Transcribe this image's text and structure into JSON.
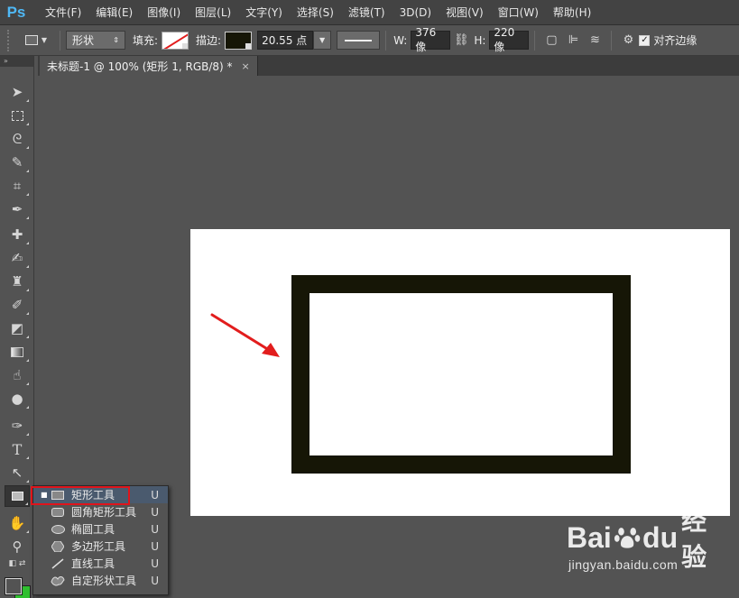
{
  "app": {
    "logo": "Ps",
    "accent": "#4fb8f5"
  },
  "menu": [
    "文件(F)",
    "编辑(E)",
    "图像(I)",
    "图层(L)",
    "文字(Y)",
    "选择(S)",
    "滤镜(T)",
    "3D(D)",
    "视图(V)",
    "窗口(W)",
    "帮助(H)"
  ],
  "options": {
    "mode_value": "形状",
    "fill_label": "填充:",
    "stroke_label": "描边:",
    "stroke_width": "20.55 点",
    "w_label": "W:",
    "w_value": "376 像",
    "h_label": "H:",
    "h_value": "220 像",
    "align_edges_label": "对齐边缘",
    "fill_color": "#ffffff",
    "stroke_color": "#161606"
  },
  "document": {
    "tab_title": "未标题-1 @ 100% (矩形 1, RGB/8) *",
    "close_glyph": "×",
    "canvas_color": "#ffffff"
  },
  "toolbox": {
    "header": "»"
  },
  "flyout": {
    "items": [
      {
        "label": "矩形工具",
        "shortcut": "U",
        "icon": "rectangle-icon"
      },
      {
        "label": "圆角矩形工具",
        "shortcut": "U",
        "icon": "rounded-rectangle-icon"
      },
      {
        "label": "椭圆工具",
        "shortcut": "U",
        "icon": "ellipse-icon"
      },
      {
        "label": "多边形工具",
        "shortcut": "U",
        "icon": "polygon-icon"
      },
      {
        "label": "直线工具",
        "shortcut": "U",
        "icon": "line-icon"
      },
      {
        "label": "自定形状工具",
        "shortcut": "U",
        "icon": "custom-shape-icon"
      }
    ],
    "selected_marker": "■",
    "highlight_color": "#e0141b"
  },
  "watermark": {
    "brand_a": "Bai",
    "brand_b": "du",
    "brand_cn": "经验",
    "url": "jingyan.baidu.com"
  }
}
